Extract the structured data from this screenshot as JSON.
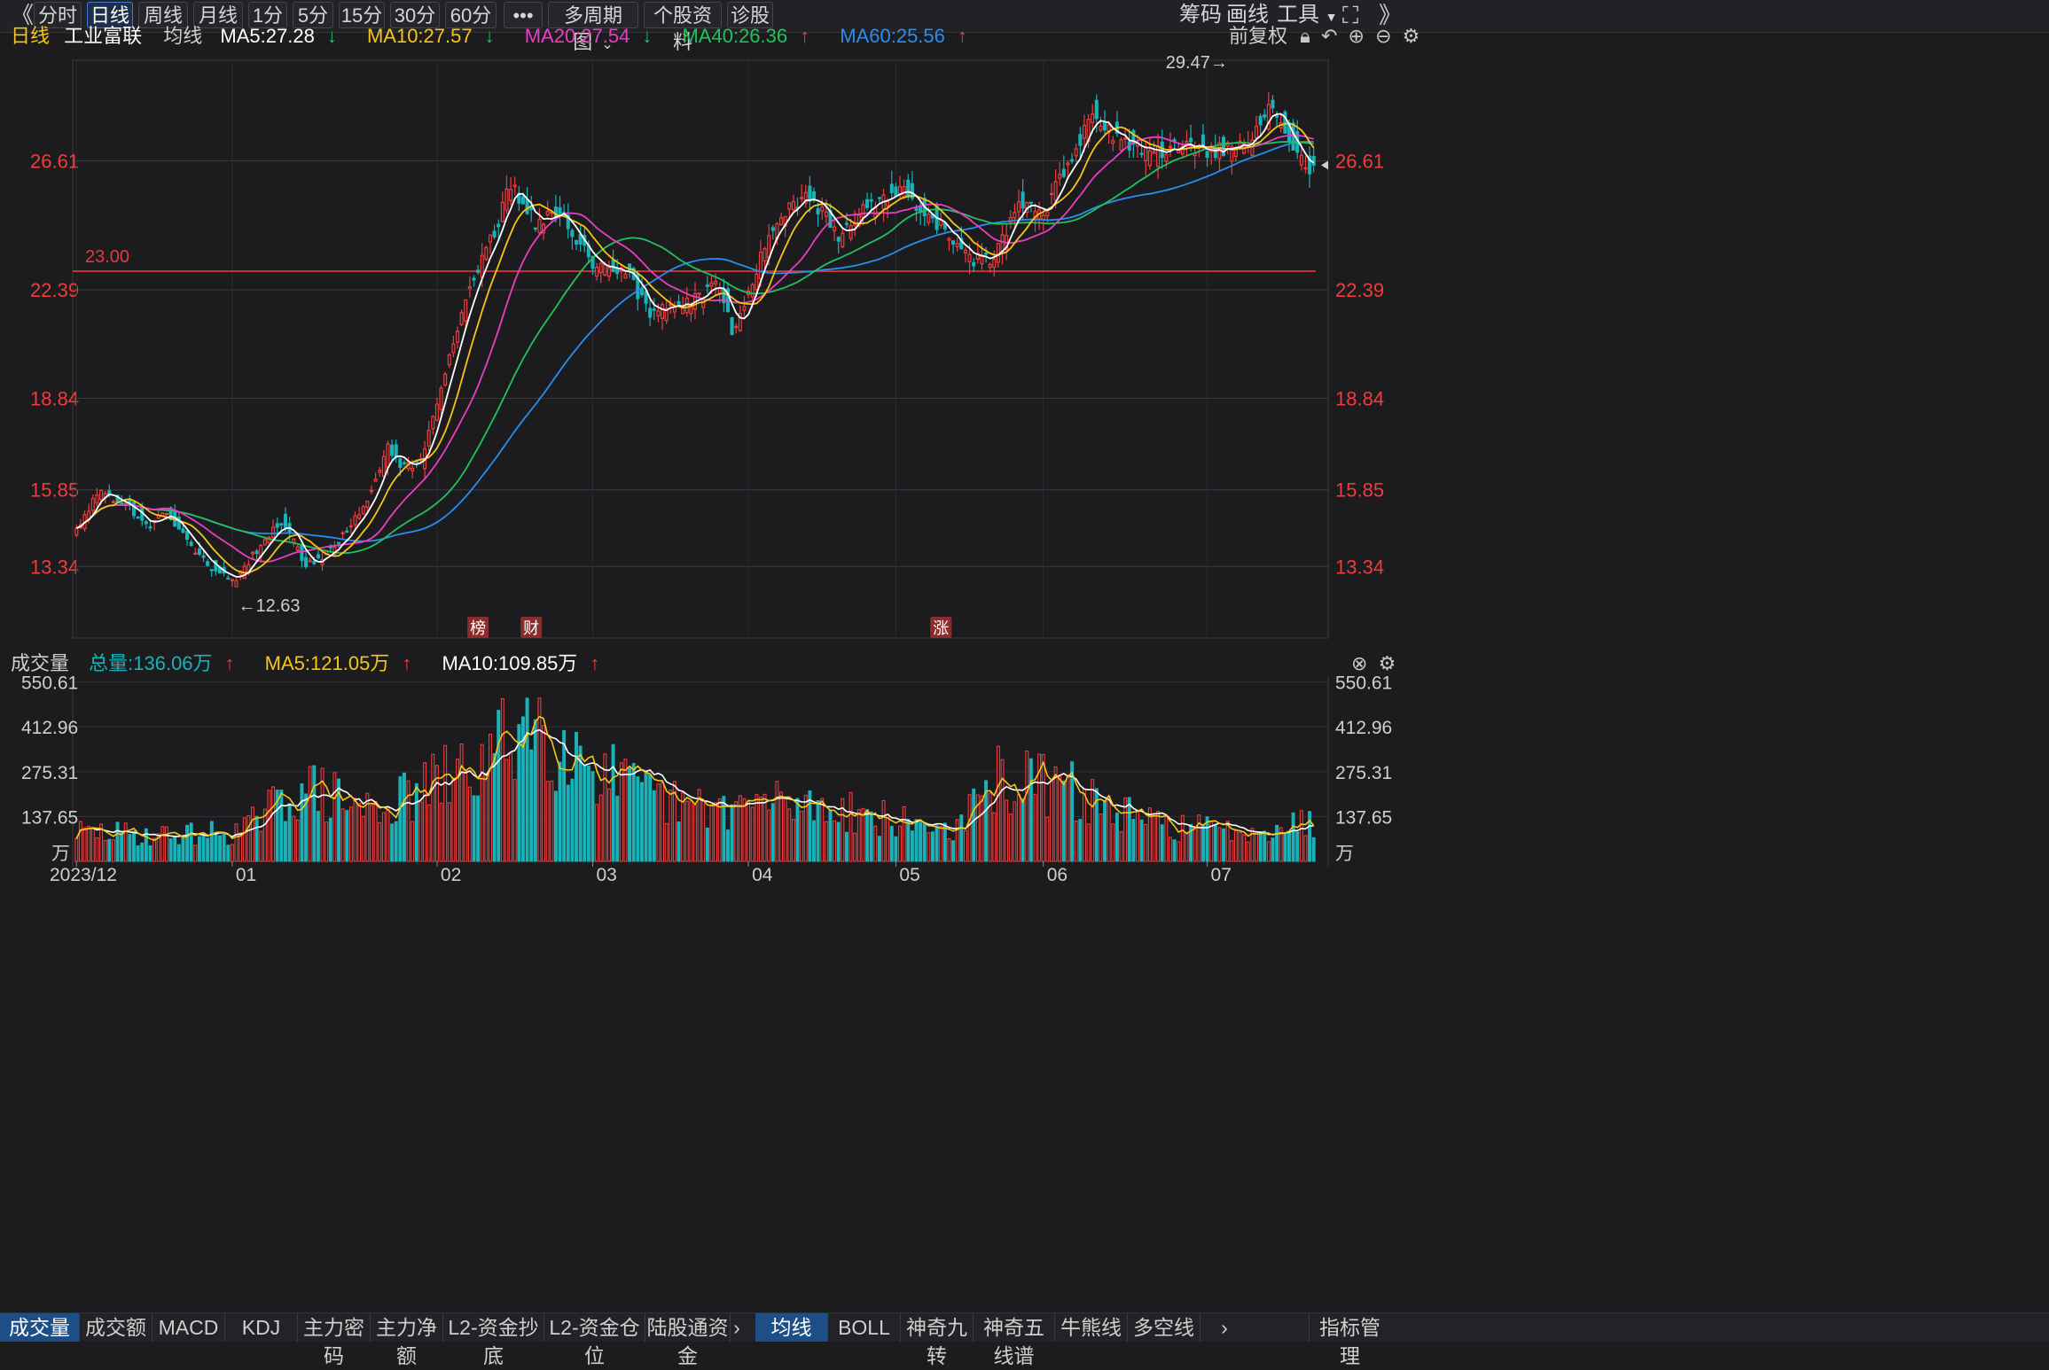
{
  "toolbar": {
    "collapse_icon": "double-chevron-left-icon",
    "periods": [
      "分时",
      "日线",
      "周线",
      "月线",
      "1分",
      "5分",
      "15分",
      "30分",
      "60分"
    ],
    "active_period": "日线",
    "more": "•••",
    "multi_period": "多周期图",
    "stock_info": "个股资料",
    "diagnose": "诊股",
    "chips": "筹码",
    "draw": "画线",
    "tools": "工具"
  },
  "price_legend": {
    "period": "日线",
    "stock_name": "工业富联",
    "ma_label": "均线",
    "ma5": "MA5:27.28",
    "ma10": "MA10:27.57",
    "ma20": "MA20:27.54",
    "ma40": "MA40:26.36",
    "ma60": "MA60:25.56",
    "adjust": "前复权",
    "colors": {
      "ma5": "#ffffff",
      "ma10": "#f5c518",
      "ma20": "#e83fc2",
      "ma40": "#21c25e",
      "ma60": "#2a8cf0",
      "up": "#f03c3c",
      "down": "#18b2b8"
    }
  },
  "volume_legend": {
    "label": "成交量",
    "total": "总量:136.06万",
    "ma5": "MA5:121.05万",
    "ma10": "MA10:109.85万"
  },
  "chart_data": [
    {
      "type": "candlestick",
      "title": "工业富联 日线",
      "x_labels": [
        "2023/12",
        "01",
        "02",
        "03",
        "04",
        "05",
        "06",
        "07"
      ],
      "y_ticks": [
        13.34,
        15.85,
        18.84,
        22.39,
        26.61
      ],
      "ylim": [
        11.0,
        29.9
      ],
      "reference_line": {
        "value": 23.0,
        "label": "23.00",
        "color": "#e23b3b"
      },
      "annotations": [
        {
          "text": "29.47→",
          "value": 29.47
        },
        {
          "text": "←12.63",
          "value": 12.63
        }
      ],
      "event_markers": [
        {
          "text": "榜"
        },
        {
          "text": "财"
        },
        {
          "text": "涨"
        }
      ],
      "series_shape": {
        "anchors": [
          [
            0,
            14.5
          ],
          [
            5,
            15.8
          ],
          [
            12,
            15.4
          ],
          [
            18,
            14.6
          ],
          [
            22,
            15.2
          ],
          [
            28,
            13.9
          ],
          [
            38,
            12.8
          ],
          [
            43,
            13.7
          ],
          [
            50,
            14.8
          ],
          [
            56,
            13.4
          ],
          [
            60,
            13.6
          ],
          [
            70,
            15.2
          ],
          [
            76,
            17.2
          ],
          [
            80,
            16.6
          ],
          [
            84,
            16.8
          ],
          [
            88,
            18.6
          ],
          [
            92,
            20.6
          ],
          [
            96,
            22.6
          ],
          [
            100,
            23.6
          ],
          [
            106,
            25.8
          ],
          [
            112,
            24.6
          ],
          [
            118,
            25.0
          ],
          [
            126,
            23.2
          ],
          [
            134,
            23.0
          ],
          [
            140,
            21.6
          ],
          [
            150,
            22.0
          ],
          [
            157,
            22.6
          ],
          [
            160,
            21.0
          ],
          [
            164,
            22.4
          ],
          [
            170,
            24.4
          ],
          [
            178,
            25.6
          ],
          [
            186,
            24.2
          ],
          [
            194,
            25.2
          ],
          [
            202,
            25.6
          ],
          [
            210,
            24.6
          ],
          [
            218,
            23.4
          ],
          [
            224,
            23.4
          ],
          [
            230,
            25.4
          ],
          [
            236,
            24.8
          ],
          [
            242,
            26.6
          ],
          [
            248,
            28.1
          ],
          [
            256,
            27.2
          ],
          [
            262,
            26.8
          ],
          [
            270,
            27.1
          ],
          [
            278,
            26.9
          ],
          [
            286,
            27.2
          ],
          [
            292,
            28.4
          ],
          [
            298,
            26.9
          ],
          [
            302,
            26.3
          ]
        ],
        "count": 303,
        "seed": 17
      }
    },
    {
      "type": "bar",
      "title": "成交量",
      "unit": "万",
      "y_ticks": [
        137.65,
        275.31,
        412.96,
        550.61
      ],
      "ylim": [
        0,
        566
      ],
      "profile": {
        "anchors": [
          [
            0,
            90
          ],
          [
            20,
            80
          ],
          [
            40,
            90
          ],
          [
            55,
            230
          ],
          [
            70,
            160
          ],
          [
            80,
            190
          ],
          [
            90,
            250
          ],
          [
            100,
            300
          ],
          [
            110,
            450
          ],
          [
            120,
            360
          ],
          [
            135,
            220
          ],
          [
            150,
            160
          ],
          [
            170,
            180
          ],
          [
            185,
            170
          ],
          [
            200,
            120
          ],
          [
            215,
            100
          ],
          [
            225,
            250
          ],
          [
            240,
            230
          ],
          [
            260,
            120
          ],
          [
            280,
            95
          ],
          [
            302,
            120
          ]
        ],
        "seed": 29
      }
    }
  ],
  "volume_indicator_tabs": [
    "成交量",
    "成交额",
    "MACD",
    "KDJ",
    "主力密码",
    "主力净额",
    "L2-资金抄底",
    "L2-资金仓位",
    "陆股通资金"
  ],
  "price_indicator_tabs": [
    "均线",
    "BOLL",
    "神奇九转",
    "神奇五线谱",
    "牛熊线",
    "多空线"
  ],
  "indicator_manage": "指标管理"
}
